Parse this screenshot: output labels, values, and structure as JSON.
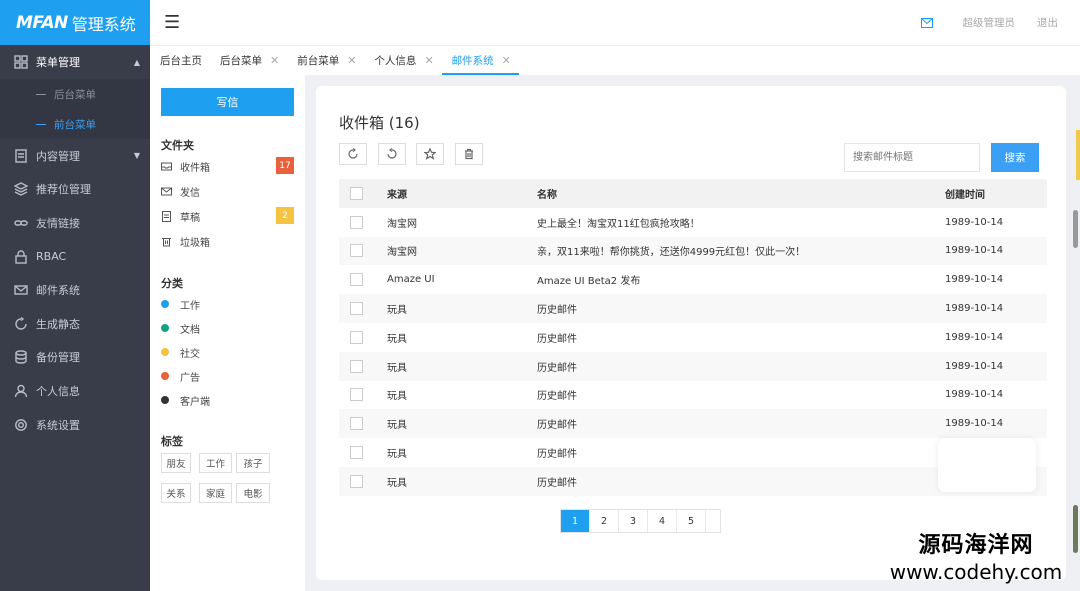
{
  "brand": {
    "logo": "MFAN",
    "name": "管理系统"
  },
  "sidebar": {
    "items": [
      {
        "label": "菜单管理",
        "icon": "grid-icon",
        "open": true
      },
      {
        "label": "内容管理",
        "icon": "document-icon",
        "caret": true
      },
      {
        "label": "推荐位管理",
        "icon": "layers-icon"
      },
      {
        "label": "友情链接",
        "icon": "link-icon"
      },
      {
        "label": "RBAC",
        "icon": "lock-icon"
      },
      {
        "label": "邮件系统",
        "icon": "mail-icon"
      },
      {
        "label": "生成静态",
        "icon": "refresh-icon"
      },
      {
        "label": "备份管理",
        "icon": "database-icon"
      },
      {
        "label": "个人信息",
        "icon": "user-icon"
      },
      {
        "label": "系统设置",
        "icon": "gear-icon"
      }
    ],
    "submenu": [
      {
        "label": "后台菜单"
      },
      {
        "label": "前台菜单",
        "active": true
      }
    ]
  },
  "topbar": {
    "user": "超级管理员",
    "logout": "退出"
  },
  "tabs": [
    {
      "label": "后台主页",
      "closable": false
    },
    {
      "label": "后台菜单",
      "closable": true
    },
    {
      "label": "前台菜单",
      "closable": true
    },
    {
      "label": "个人信息",
      "closable": true
    },
    {
      "label": "邮件系统",
      "closable": true,
      "active": true
    }
  ],
  "left_panel": {
    "compose": "写信",
    "folders_title": "文件夹",
    "folders": [
      {
        "label": "收件箱",
        "icon": "inbox-icon",
        "badge": "17",
        "badge_color": "#e8603c"
      },
      {
        "label": "发信",
        "icon": "envelope-icon"
      },
      {
        "label": "草稿",
        "icon": "draft-icon",
        "badge": "2",
        "badge_color": "#f5c242"
      },
      {
        "label": "垃圾箱",
        "icon": "trash-icon"
      }
    ],
    "categories_title": "分类",
    "categories": [
      {
        "label": "工作",
        "color": "#1f9ff0"
      },
      {
        "label": "文档",
        "color": "#16a085"
      },
      {
        "label": "社交",
        "color": "#f5c242"
      },
      {
        "label": "广告",
        "color": "#e8603c"
      },
      {
        "label": "客户端",
        "color": "#333333"
      }
    ],
    "tags_title": "标签",
    "tags": [
      "朋友",
      "工作",
      "孩子",
      "关系",
      "家庭",
      "电影"
    ]
  },
  "main": {
    "title": "收件箱 (16)",
    "search_placeholder": "搜索邮件标题",
    "search_button": "搜索",
    "columns": {
      "source": "来源",
      "name": "名称",
      "created": "创建时间"
    },
    "rows": [
      {
        "source": "淘宝网",
        "name": "史上最全！淘宝双11红包疯抢攻略！",
        "date": "1989-10-14"
      },
      {
        "source": "淘宝网",
        "name": "亲，双11来啦！帮你挑货，还送你4999元红包！仅此一次！",
        "date": "1989-10-14"
      },
      {
        "source": "Amaze UI",
        "name": "Amaze UI Beta2 发布",
        "date": "1989-10-14"
      },
      {
        "source": "玩具",
        "name": "历史邮件",
        "date": "1989-10-14"
      },
      {
        "source": "玩具",
        "name": "历史邮件",
        "date": "1989-10-14"
      },
      {
        "source": "玩具",
        "name": "历史邮件",
        "date": "1989-10-14"
      },
      {
        "source": "玩具",
        "name": "历史邮件",
        "date": "1989-10-14"
      },
      {
        "source": "玩具",
        "name": "历史邮件",
        "date": "1989-10-14"
      },
      {
        "source": "玩具",
        "name": "历史邮件",
        "date": ""
      },
      {
        "source": "玩具",
        "name": "历史邮件",
        "date": ""
      }
    ],
    "pages": [
      "1",
      "2",
      "3",
      "4",
      "5",
      ""
    ]
  },
  "watermark": {
    "line1": "源码海洋网",
    "line2": "www.codehy.com"
  }
}
